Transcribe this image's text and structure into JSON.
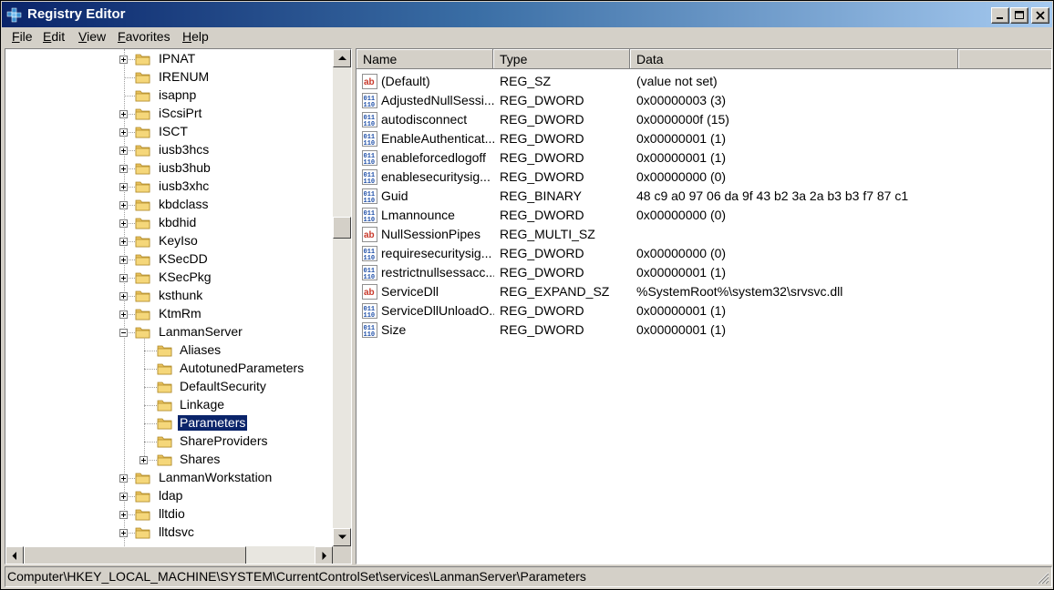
{
  "window": {
    "title": "Registry Editor"
  },
  "menu": [
    {
      "label": "File",
      "u": "F",
      "rest": "ile"
    },
    {
      "label": "Edit",
      "u": "E",
      "rest": "dit"
    },
    {
      "label": "View",
      "u": "V",
      "rest": "iew"
    },
    {
      "label": "Favorites",
      "u": "F",
      "rest": "avorites"
    },
    {
      "label": "Help",
      "u": "H",
      "rest": "elp"
    }
  ],
  "tree": {
    "items": [
      {
        "label": "IPNAT",
        "level": 1,
        "expander": "plus"
      },
      {
        "label": "IRENUM",
        "level": 1,
        "expander": "none"
      },
      {
        "label": "isapnp",
        "level": 1,
        "expander": "none"
      },
      {
        "label": "iScsiPrt",
        "level": 1,
        "expander": "plus"
      },
      {
        "label": "ISCT",
        "level": 1,
        "expander": "plus"
      },
      {
        "label": "iusb3hcs",
        "level": 1,
        "expander": "plus"
      },
      {
        "label": "iusb3hub",
        "level": 1,
        "expander": "plus"
      },
      {
        "label": "iusb3xhc",
        "level": 1,
        "expander": "plus"
      },
      {
        "label": "kbdclass",
        "level": 1,
        "expander": "plus"
      },
      {
        "label": "kbdhid",
        "level": 1,
        "expander": "plus"
      },
      {
        "label": "KeyIso",
        "level": 1,
        "expander": "plus"
      },
      {
        "label": "KSecDD",
        "level": 1,
        "expander": "plus"
      },
      {
        "label": "KSecPkg",
        "level": 1,
        "expander": "plus"
      },
      {
        "label": "ksthunk",
        "level": 1,
        "expander": "plus"
      },
      {
        "label": "KtmRm",
        "level": 1,
        "expander": "plus"
      },
      {
        "label": "LanmanServer",
        "level": 1,
        "expander": "minus"
      },
      {
        "label": "Aliases",
        "level": 2,
        "expander": "none"
      },
      {
        "label": "AutotunedParameters",
        "level": 2,
        "expander": "none"
      },
      {
        "label": "DefaultSecurity",
        "level": 2,
        "expander": "none"
      },
      {
        "label": "Linkage",
        "level": 2,
        "expander": "none"
      },
      {
        "label": "Parameters",
        "level": 2,
        "expander": "none",
        "selected": true
      },
      {
        "label": "ShareProviders",
        "level": 2,
        "expander": "none"
      },
      {
        "label": "Shares",
        "level": 2,
        "expander": "plus"
      },
      {
        "label": "LanmanWorkstation",
        "level": 1,
        "expander": "plus"
      },
      {
        "label": "ldap",
        "level": 1,
        "expander": "plus"
      },
      {
        "label": "lltdio",
        "level": 1,
        "expander": "plus"
      },
      {
        "label": "lltdsvc",
        "level": 1,
        "expander": "plus"
      }
    ]
  },
  "list": {
    "columns": [
      "Name",
      "Type",
      "Data"
    ],
    "rows": [
      {
        "icon": "string",
        "name": "(Default)",
        "type": "REG_SZ",
        "data": "(value not set)"
      },
      {
        "icon": "binary",
        "name": "AdjustedNullSessi...",
        "type": "REG_DWORD",
        "data": "0x00000003 (3)"
      },
      {
        "icon": "binary",
        "name": "autodisconnect",
        "type": "REG_DWORD",
        "data": "0x0000000f (15)"
      },
      {
        "icon": "binary",
        "name": "EnableAuthenticat...",
        "type": "REG_DWORD",
        "data": "0x00000001 (1)"
      },
      {
        "icon": "binary",
        "name": "enableforcedlogoff",
        "type": "REG_DWORD",
        "data": "0x00000001 (1)"
      },
      {
        "icon": "binary",
        "name": "enablesecuritysig...",
        "type": "REG_DWORD",
        "data": "0x00000000 (0)"
      },
      {
        "icon": "binary",
        "name": "Guid",
        "type": "REG_BINARY",
        "data": "48 c9 a0 97 06 da 9f 43 b2 3a 2a b3 b3 f7 87 c1"
      },
      {
        "icon": "binary",
        "name": "Lmannounce",
        "type": "REG_DWORD",
        "data": "0x00000000 (0)"
      },
      {
        "icon": "string",
        "name": "NullSessionPipes",
        "type": "REG_MULTI_SZ",
        "data": ""
      },
      {
        "icon": "binary",
        "name": "requiresecuritysig...",
        "type": "REG_DWORD",
        "data": "0x00000000 (0)"
      },
      {
        "icon": "binary",
        "name": "restrictnullsessacc...",
        "type": "REG_DWORD",
        "data": "0x00000001 (1)"
      },
      {
        "icon": "string",
        "name": "ServiceDll",
        "type": "REG_EXPAND_SZ",
        "data": "%SystemRoot%\\system32\\srvsvc.dll"
      },
      {
        "icon": "binary",
        "name": "ServiceDllUnloadO...",
        "type": "REG_DWORD",
        "data": "0x00000001 (1)"
      },
      {
        "icon": "binary",
        "name": "Size",
        "type": "REG_DWORD",
        "data": "0x00000001 (1)"
      }
    ]
  },
  "statusbar": {
    "path": "Computer\\HKEY_LOCAL_MACHINE\\SYSTEM\\CurrentControlSet\\services\\LanmanServer\\Parameters"
  },
  "colors": {
    "titlebar_start": "#0a246a",
    "titlebar_end": "#a6caf0",
    "selection": "#0a246a",
    "folder": "#e8c15c",
    "string_icon": "#c8382a",
    "binary_icon": "#1f4fa8"
  }
}
